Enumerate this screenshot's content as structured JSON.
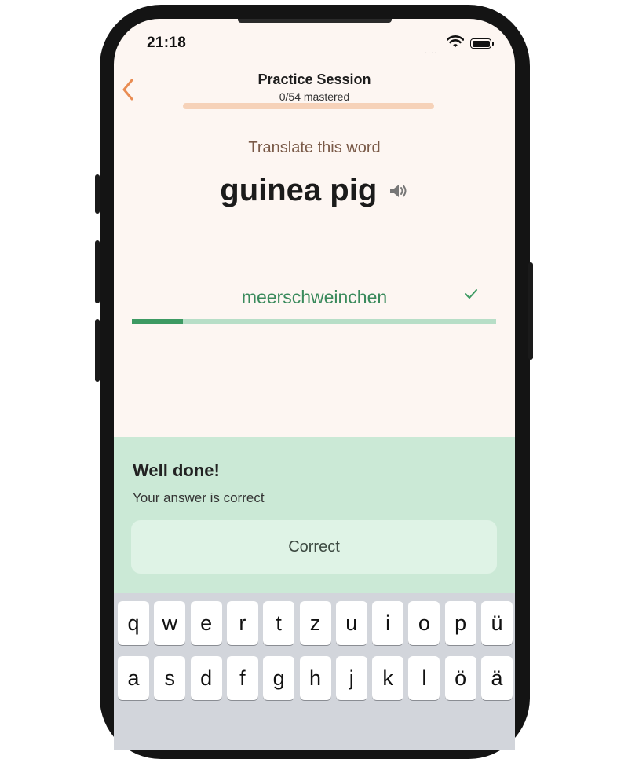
{
  "status_bar": {
    "time": "21:18",
    "signal": "...."
  },
  "header": {
    "title": "Practice Session",
    "subtitle": "0/54 mastered",
    "progress": 0
  },
  "prompt": {
    "instruction": "Translate this word",
    "word": "guinea pig"
  },
  "answer": {
    "value": "meerschweinchen",
    "progress": 0.14
  },
  "feedback": {
    "title": "Well done!",
    "message": "Your answer is correct",
    "button_label": "Correct"
  },
  "keyboard": {
    "row1": [
      "q",
      "w",
      "e",
      "r",
      "t",
      "z",
      "u",
      "i",
      "o",
      "p",
      "ü"
    ],
    "row2": [
      "a",
      "s",
      "d",
      "f",
      "g",
      "h",
      "j",
      "k",
      "l",
      "ö",
      "ä"
    ]
  },
  "colors": {
    "accent": "#e98c53",
    "success": "#3d9a63",
    "feedback_bg": "#cbe9d6",
    "background": "#fdf6f2"
  }
}
